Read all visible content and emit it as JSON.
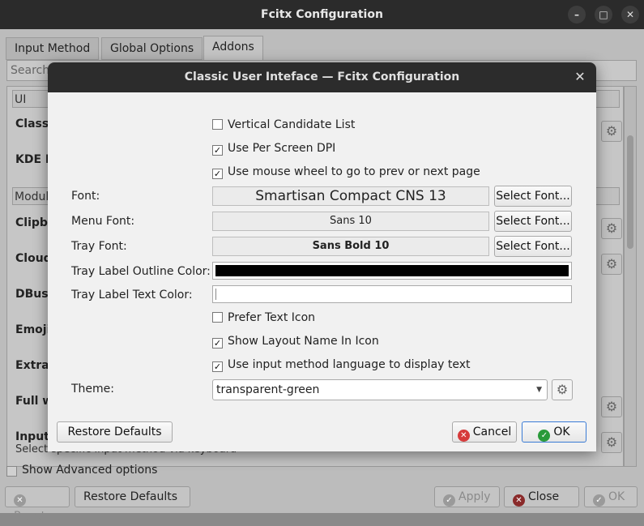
{
  "main_window": {
    "title": "Fcitx Configuration",
    "tabs": [
      "Input Method",
      "Global Options",
      "Addons"
    ],
    "search_placeholder": "Search",
    "list": {
      "section_ui": "UI",
      "ui_items": [
        "Classi",
        "KDE I"
      ],
      "section_module": "Modul",
      "module_items": [
        "Clipbo",
        "Cloud",
        "DBus",
        "Emoji",
        "Extra",
        "Full w",
        "Input"
      ],
      "partial_sub": "Select specific input method via keyboard"
    },
    "show_advanced_label": "Show Advanced options",
    "bottom_buttons": {
      "reset": "Reset",
      "restore": "Restore Defaults",
      "apply": "Apply",
      "close": "Close",
      "ok": "OK"
    }
  },
  "dialog": {
    "title": "Classic User Inteface — Fcitx Configuration",
    "checkboxes": [
      {
        "label": "Vertical Candidate List",
        "checked": false
      },
      {
        "label": "Use Per Screen DPI",
        "checked": true
      },
      {
        "label": "Use mouse wheel to go to prev or next page",
        "checked": true
      }
    ],
    "font": {
      "label": "Font:",
      "value": "Smartisan Compact CNS 13"
    },
    "menu_font": {
      "label": "Menu Font:",
      "value": "Sans 10"
    },
    "tray_font": {
      "label": "Tray Font:",
      "value": "Sans Bold 10"
    },
    "select_font_label": "Select Font...",
    "tray_outline_color": {
      "label": "Tray Label Outline Color:",
      "color": "#000000"
    },
    "tray_text_color": {
      "label": "Tray Label Text Color:",
      "color": "#ffffff"
    },
    "checkboxes2": [
      {
        "label": "Prefer Text Icon",
        "checked": false
      },
      {
        "label": "Show Layout Name In Icon",
        "checked": true
      },
      {
        "label": "Use input method language to display text",
        "checked": true
      }
    ],
    "theme": {
      "label": "Theme:",
      "value": "transparent-green"
    },
    "buttons": {
      "restore": "Restore Defaults",
      "cancel": "Cancel",
      "ok": "OK"
    }
  },
  "colors": {
    "cancel_icon": "#d63a3a",
    "ok_icon": "#2a9a3a",
    "ok_border": "#3a7bd5"
  }
}
